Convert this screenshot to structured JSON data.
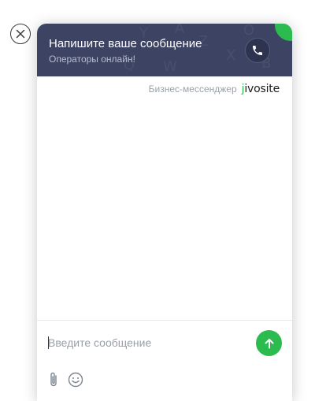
{
  "header": {
    "title": "Напишите ваше сообщение",
    "subtitle": "Операторы онлайн!"
  },
  "branding": {
    "label": "Бизнес-мессенджер",
    "logo_text": "ivosite",
    "logo_mark": "j"
  },
  "composer": {
    "placeholder": "Введите сообщение",
    "value": ""
  },
  "icons": {
    "close": "close-icon",
    "call": "phone-icon",
    "send": "arrow-up-icon",
    "attach": "paperclip-icon",
    "emoji": "smiley-icon"
  },
  "colors": {
    "header_bg": "#3d4463",
    "accent": "#2bbb4f",
    "placeholder": "#9aa0aa"
  }
}
